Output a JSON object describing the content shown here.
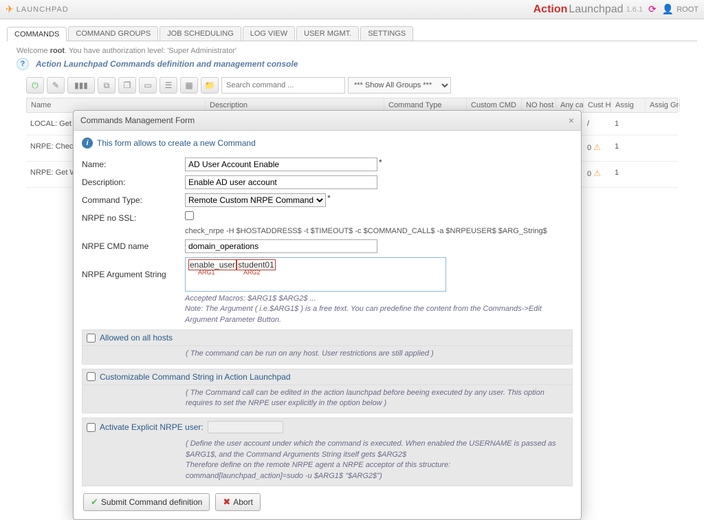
{
  "topbar": {
    "title": "LAUNCHPAD",
    "brand1": "Action",
    "brand2": "Launchpad",
    "version": "1.6.1",
    "user": "ROOT"
  },
  "tabs": [
    "COMMANDS",
    "COMMAND GROUPS",
    "JOB SCHEDULING",
    "LOG VIEW",
    "USER MGMT.",
    "SETTINGS"
  ],
  "welcome": {
    "pre": "Welcome ",
    "user": "root",
    "post": ". You have authorization level: 'Super Administrator'"
  },
  "consoleTitle": "Action Launchpad Commands definition and management console",
  "search": {
    "placeholder": "Search command ..."
  },
  "groupFilter": "*** Show All Groups ***",
  "grid": {
    "headers": [
      "Name",
      "Description",
      "Command Type",
      "Custom CMD",
      "NO host",
      "Any call",
      "Cust Hosts",
      "Assig",
      "Assig Groups"
    ],
    "rows": [
      {
        "name": "LOCAL: Get",
        "cust": "/",
        "assig": "1"
      },
      {
        "name": "NRPE: Check",
        "ok": true,
        "cust": "0",
        "warn": true,
        "assig": "1"
      },
      {
        "name": "NRPE: Get W",
        "ok": true,
        "cust": "0",
        "warn": true,
        "assig": "1"
      }
    ]
  },
  "modal": {
    "title": "Commands Management Form",
    "info": "This form allows to create a new Command",
    "labels": {
      "name": "Name:",
      "description": "Description:",
      "cmdType": "Command Type:",
      "noSSL": "NRPE no SSL:",
      "cmdName": "NRPE CMD name",
      "argString": "NRPE Argument String"
    },
    "values": {
      "name": "AD User Account Enable",
      "description": "Enable AD user account",
      "cmdType": "Remote Custom NRPE Command",
      "cmdLine": "check_nrpe -H $HOSTADDRESS$ -t $TIMEOUT$ -c $COMMAND_CALL$ -a $NRPEUSER$ $ARG_String$",
      "cmdName": "domain_operations",
      "arg1": "enable_user",
      "arg2": "student01",
      "argLabel1": "ARG1",
      "argLabel2": "ARG2",
      "argHint": "Accepted Macros: $ARG1$ $ARG2$ ...\nNote: The Argument ( i.e.$ARG1$ ) is a free text. You can predefine the content from the Commands->Edit Argument Parameter Button."
    },
    "sections": {
      "allowed": "Allowed on all hosts",
      "allowedDesc": "( The command can be run on any host. User restrictions are still applied )",
      "customizable": "Customizable Command String in Action Launchpad",
      "customizableDesc": "( The Command call can be edited in the action launchpad before beeing executed by any user. This option requires to set the NRPE user explicitly in the option below )",
      "explicit": "Activate Explicit NRPE user:",
      "explicitDesc": "( Define the user account under which the command is executed. When enabled the USERNAME is passed as $ARG1$, and the Command Arguments String itself gets $ARG2$\nTherefore define on the remote NRPE agent a NRPE acceptor of this structure:\ncommand[launchpad_action]=sudo -u $ARG1$ \"$ARG2$\")"
    },
    "buttons": {
      "submit": "Submit Command definition",
      "abort": "Abort"
    }
  }
}
